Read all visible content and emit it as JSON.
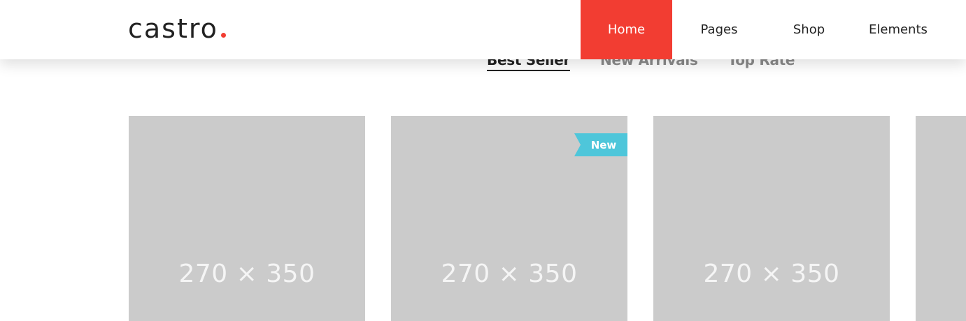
{
  "header": {
    "logo": "castro",
    "nav": [
      {
        "label": "Home",
        "active": true
      },
      {
        "label": "Pages",
        "active": false
      },
      {
        "label": "Shop",
        "active": false
      },
      {
        "label": "Elements",
        "active": false
      }
    ]
  },
  "tabs": [
    {
      "label": "Best Seller",
      "active": true
    },
    {
      "label": "New Arrivals",
      "active": false
    },
    {
      "label": "Top Rate",
      "active": false
    }
  ],
  "products": [
    {
      "placeholder": "270 × 350",
      "badge": ""
    },
    {
      "placeholder": "270 × 350",
      "badge": "New"
    },
    {
      "placeholder": "270 × 350",
      "badge": ""
    },
    {
      "placeholder": "",
      "badge": ""
    }
  ],
  "colors": {
    "accent": "#f23d32",
    "badge": "#4ec6da",
    "placeholder_bg": "#cbcbcb",
    "text_dark": "#222222",
    "text_muted": "#8a8a8a"
  }
}
